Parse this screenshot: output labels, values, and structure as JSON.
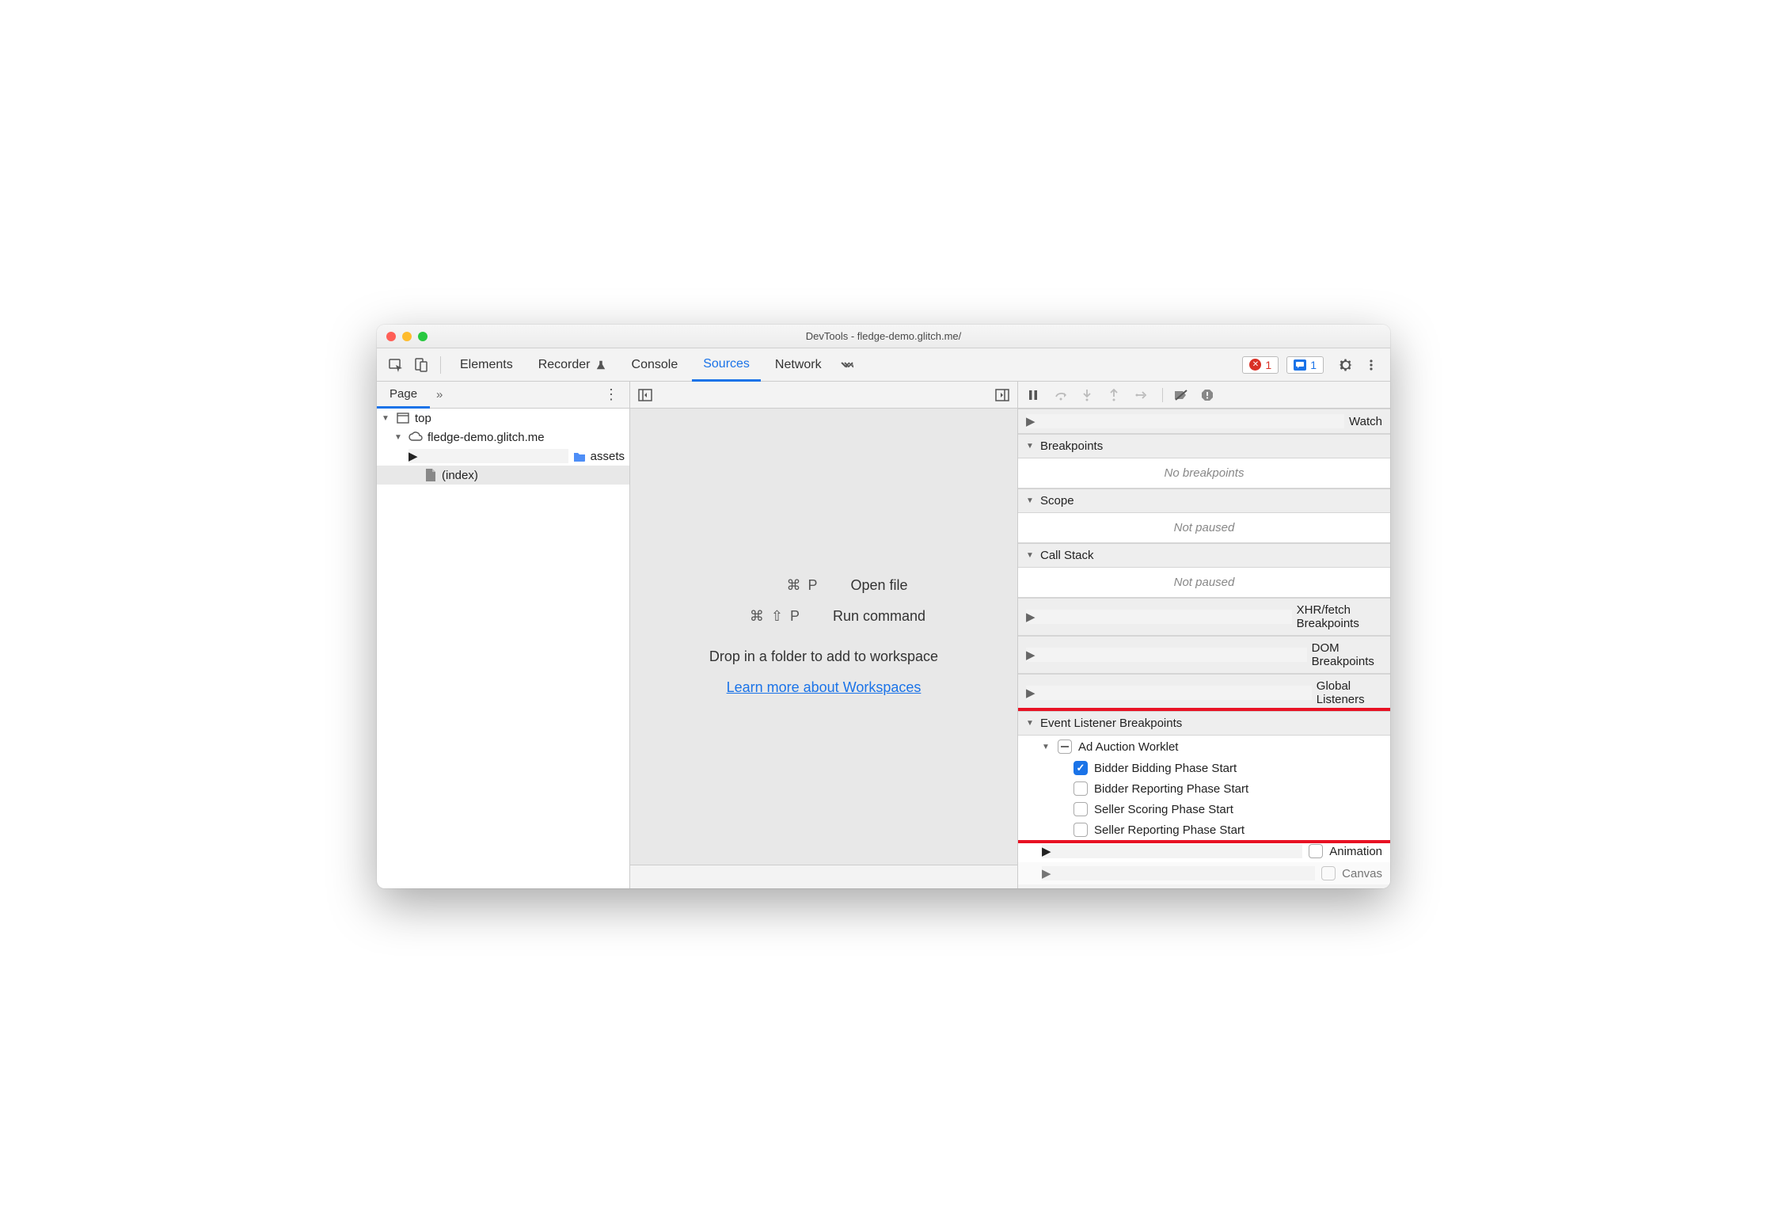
{
  "title": "DevTools - fledge-demo.glitch.me/",
  "tabs": {
    "elements": "Elements",
    "recorder": "Recorder",
    "console": "Console",
    "sources": "Sources",
    "network": "Network"
  },
  "badges": {
    "errors": "1",
    "messages": "1"
  },
  "subtabs": {
    "page": "Page"
  },
  "tree": {
    "top": "top",
    "origin": "fledge-demo.glitch.me",
    "assets": "assets",
    "index": "(index)"
  },
  "center": {
    "open_file_keys": "⌘ P",
    "open_file_label": "Open file",
    "run_cmd_keys": "⌘ ⇧ P",
    "run_cmd_label": "Run command",
    "drop_hint": "Drop in a folder to add to workspace",
    "learn_link": "Learn more about Workspaces"
  },
  "right": {
    "watch": "Watch",
    "breakpoints": "Breakpoints",
    "no_breakpoints": "No breakpoints",
    "scope": "Scope",
    "not_paused": "Not paused",
    "call_stack": "Call Stack",
    "xhr": "XHR/fetch Breakpoints",
    "dom": "DOM Breakpoints",
    "global": "Global Listeners",
    "evt_listener": "Event Listener Breakpoints",
    "ad_auction": "Ad Auction Worklet",
    "events": {
      "e1": "Bidder Bidding Phase Start",
      "e2": "Bidder Reporting Phase Start",
      "e3": "Seller Scoring Phase Start",
      "e4": "Seller Reporting Phase Start"
    },
    "animation": "Animation",
    "canvas": "Canvas"
  }
}
